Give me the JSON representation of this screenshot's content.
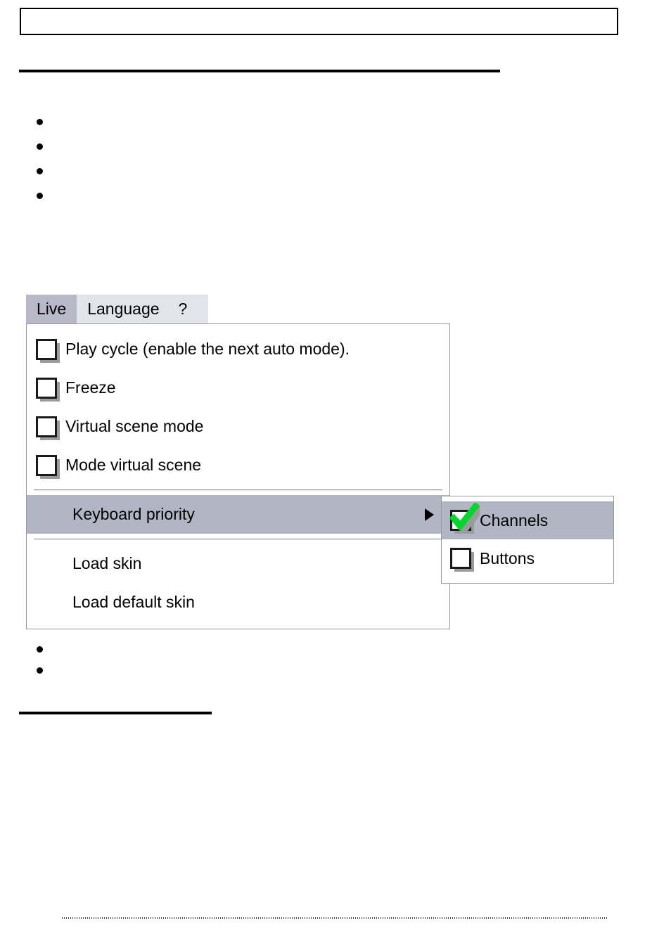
{
  "document": {
    "header_box": {
      "content": ""
    },
    "bullets_top": [
      "",
      "",
      "",
      ""
    ],
    "bullets_bottom": [
      "",
      ""
    ]
  },
  "menu_widget": {
    "menu_bar": {
      "items": [
        {
          "label": "Live",
          "active": true
        },
        {
          "label": "Language",
          "active": false
        },
        {
          "label": "?",
          "active": false
        }
      ]
    },
    "dropdown": {
      "items": [
        {
          "label": "Play cycle (enable the next auto mode).",
          "checkbox": "unchecked",
          "highlighted": false
        },
        {
          "label": "Freeze",
          "checkbox": "unchecked",
          "highlighted": false
        },
        {
          "label": "Virtual scene mode",
          "checkbox": "unchecked",
          "highlighted": false
        },
        {
          "label": "Mode virtual scene",
          "checkbox": "unchecked",
          "highlighted": false
        },
        {
          "label": "Keyboard priority",
          "checkbox": "none",
          "highlighted": true,
          "has_submenu": true
        },
        {
          "label": "Load skin",
          "checkbox": "none",
          "highlighted": false
        },
        {
          "label": "Load default skin",
          "checkbox": "none",
          "highlighted": false
        }
      ]
    },
    "submenu": {
      "parent": "Keyboard priority",
      "items": [
        {
          "label": "Channels",
          "checkbox": "checked",
          "highlighted": true
        },
        {
          "label": "Buttons",
          "checkbox": "unchecked",
          "highlighted": false
        }
      ]
    }
  },
  "colors": {
    "menu_bar_background": "#e2e4ec",
    "menu_bar_active": "#b8b8c8",
    "highlight": "#b2b5c4",
    "panel_background": "#ffffff",
    "panel_border": "#9a9a9a",
    "check_green": "#00d72b",
    "text": "#000000",
    "shadow_gray": "#9b9b9b",
    "rule_black": "#000000"
  }
}
